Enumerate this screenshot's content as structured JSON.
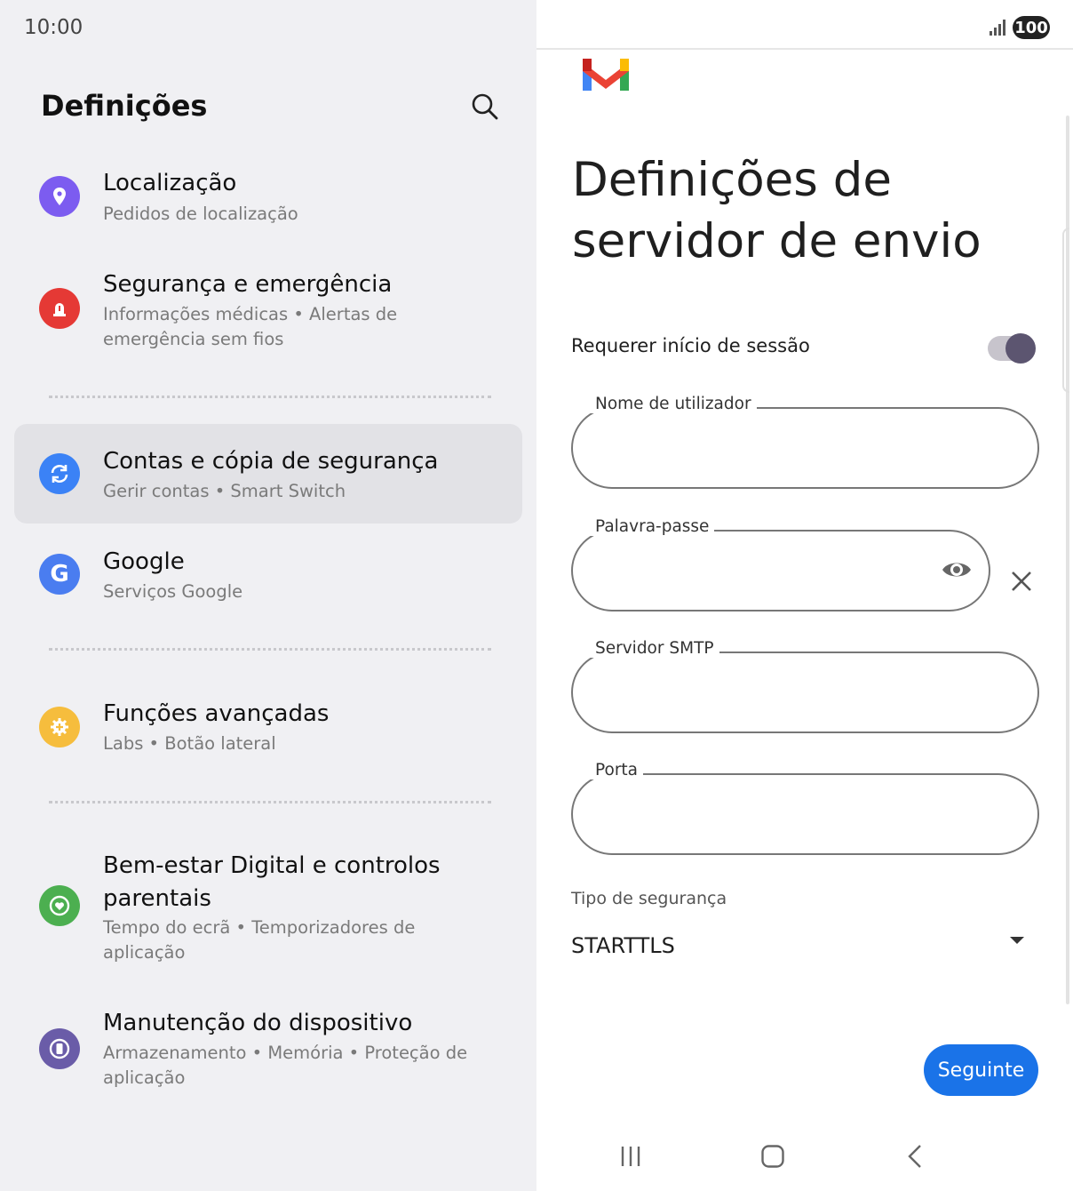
{
  "status": {
    "time": "10:00",
    "battery": "100"
  },
  "settings": {
    "title": "Definições",
    "items": [
      {
        "title": "Localização",
        "subtitle": "Pedidos de localização",
        "icon": "location-pin-icon",
        "color": "#7c5cf0"
      },
      {
        "title": "Segurança e emergência",
        "subtitle": "Informações médicas • Alertas de emergência sem fios",
        "icon": "emergency-alert-icon",
        "color": "#e53935"
      },
      {
        "title": "Contas e cópia de segurança",
        "subtitle": "Gerir contas • Smart Switch",
        "icon": "sync-icon",
        "color": "#3b82f6",
        "selected": true
      },
      {
        "title": "Google",
        "subtitle": "Serviços Google",
        "icon": "google-g-icon",
        "color": "#4a7df0"
      },
      {
        "title": "Funções avançadas",
        "subtitle": "Labs • Botão lateral",
        "icon": "gear-plus-icon",
        "color": "#f6bd3d"
      },
      {
        "title": "Bem-estar Digital e controlos parentais",
        "subtitle": "Tempo do ecrã • Temporizadores de aplicação",
        "icon": "heart-circle-icon",
        "color": "#4caf50"
      },
      {
        "title": "Manutenção do dispositivo",
        "subtitle": "Armazenamento • Memória • Proteção de aplicação",
        "icon": "battery-circle-icon",
        "color": "#6a5ca8"
      }
    ]
  },
  "server": {
    "title": "Definições de servidor de envio",
    "require_login_label": "Requerer início de sessão",
    "require_login": true,
    "fields": {
      "username_label": "Nome de utilizador",
      "password_label": "Palavra-passe",
      "smtp_label": "Servidor SMTP",
      "port_label": "Porta"
    },
    "security_label": "Tipo de segurança",
    "security_value": "STARTTLS",
    "next_label": "Seguinte"
  },
  "colors": {
    "accent": "#1a73e8",
    "toggle_knob": "#5c5570"
  }
}
